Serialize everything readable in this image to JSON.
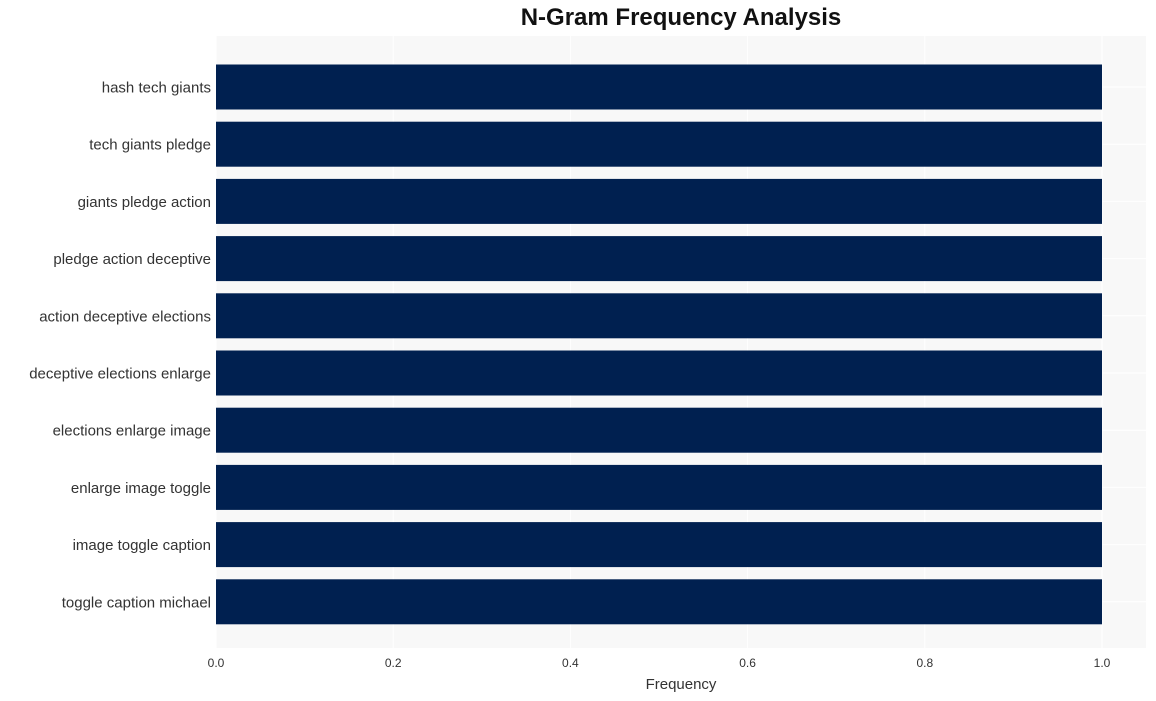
{
  "chart_data": {
    "type": "bar",
    "orientation": "horizontal",
    "title": "N-Gram Frequency Analysis",
    "xlabel": "Frequency",
    "ylabel": "",
    "categories": [
      "hash tech giants",
      "tech giants pledge",
      "giants pledge action",
      "pledge action deceptive",
      "action deceptive elections",
      "deceptive elections enlarge",
      "elections enlarge image",
      "enlarge image toggle",
      "image toggle caption",
      "toggle caption michael"
    ],
    "values": [
      1,
      1,
      1,
      1,
      1,
      1,
      1,
      1,
      1,
      1
    ],
    "xlim": [
      0,
      1.05
    ],
    "xticks": [
      0.0,
      0.2,
      0.4,
      0.6,
      0.8,
      1.0
    ],
    "xtick_labels": [
      "0.0",
      "0.2",
      "0.4",
      "0.6",
      "0.8",
      "1.0"
    ],
    "grid": true,
    "legend": "none",
    "bar_color": "#002050",
    "background_color": "#f8f8f8"
  }
}
